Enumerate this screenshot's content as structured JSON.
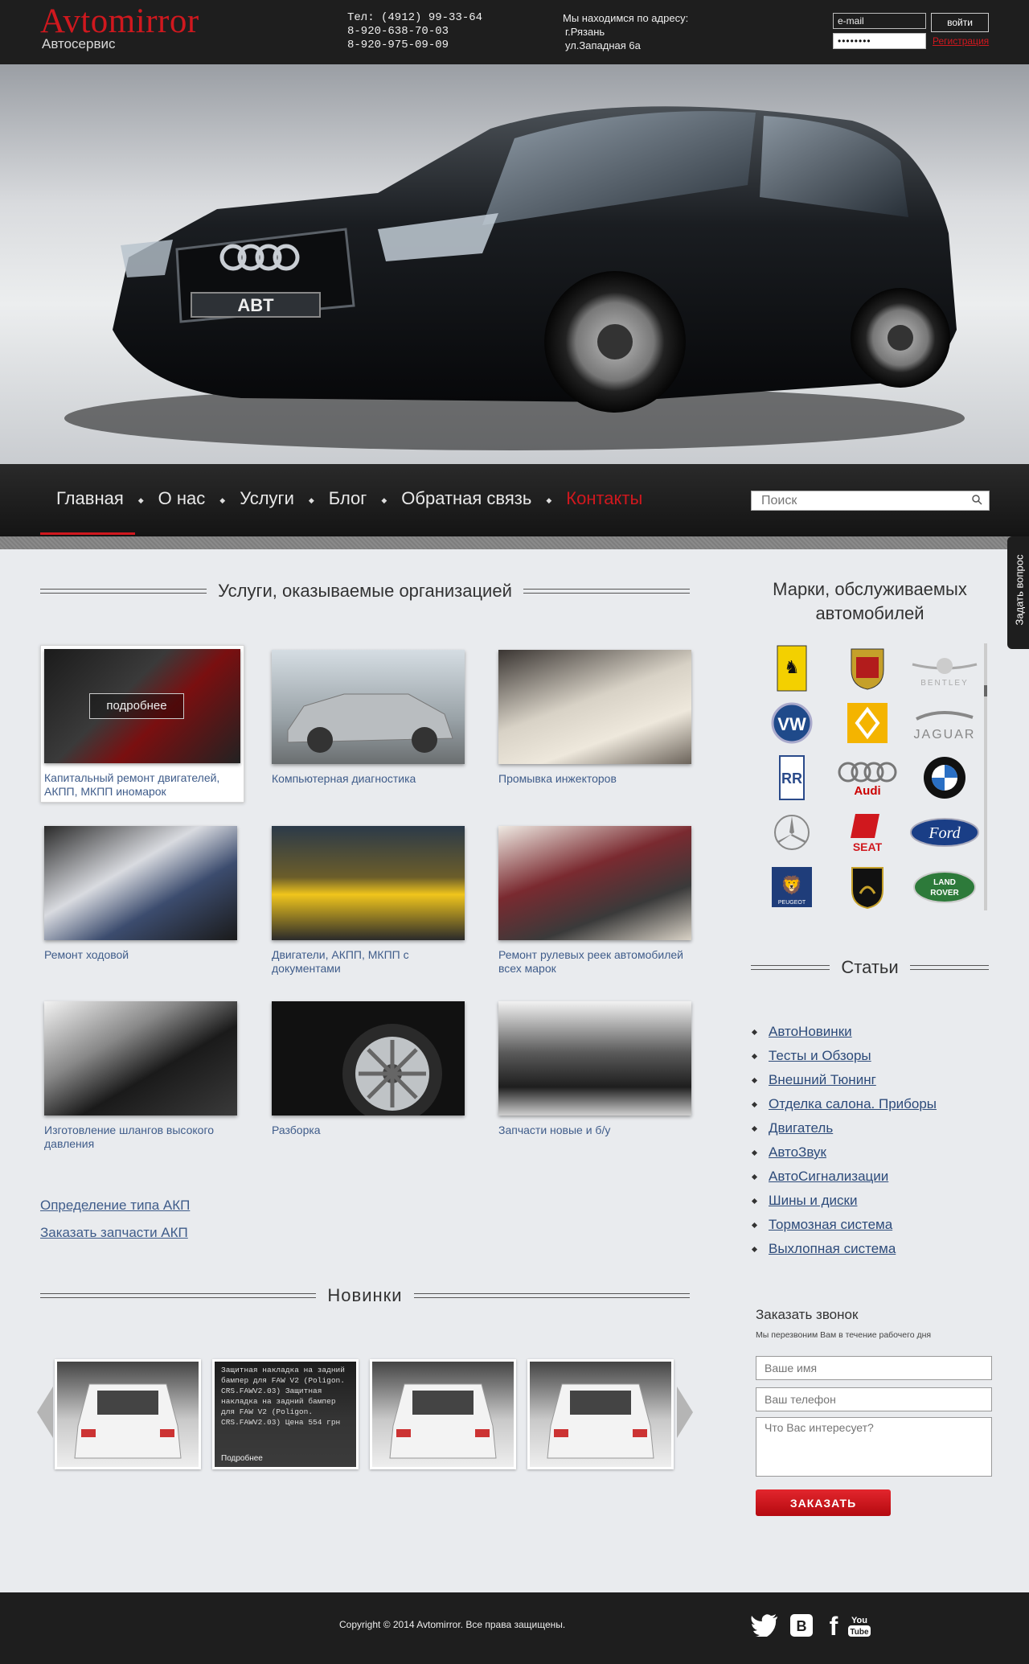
{
  "header": {
    "logo": "Avtomirror",
    "logo_sub": "Автосервис",
    "phones": [
      "Тел: (4912) 99-33-64",
      "8-920-638-70-03",
      "8-920-975-09-09"
    ],
    "address": [
      "Мы находимся по адресу:",
      "г.Рязань",
      "ул.Западная 6а"
    ],
    "email_value": "e-mail",
    "password_value": "••••••••",
    "login_label": "войти",
    "register_label": "Регистрация"
  },
  "nav": {
    "items": [
      "Главная",
      "О нас",
      "Услуги",
      "Блог",
      "Обратная связь",
      "Контакты"
    ],
    "active": "Контакты",
    "search_placeholder": "Поиск"
  },
  "side_tab": "Задать вопрос",
  "services": {
    "title": "Услуги, оказываемые организацией",
    "more_label": "подробнее",
    "items": [
      "Капитальный ремонт двигателей, АКПП, МКПП иномарок",
      "Компьютерная диагностика",
      "Промывка инжекторов",
      "Ремонт ходовой",
      "Двигатели, АКПП, МКПП с документами",
      "Ремонт рулевых реек автомобилей всех марок",
      "Изготовление шлангов высокого давления",
      "Разборка",
      "Запчасти новые и б/у"
    ]
  },
  "links": [
    "Определение типа АКП",
    "Заказать запчасти АКП"
  ],
  "novinki": {
    "title": "Новинки",
    "overlay_text": "Защитная накладка на задний бампер для FAW V2 (Poligon. CRS.FAWV2.03) Защитная накладка на задний бампер для FAW V2 (Poligon. CRS.FAWV2.03) Цена 554 грн",
    "overlay_more": "Подробнее"
  },
  "brands": {
    "title": "Марки, обслуживаемых автомобилей",
    "items": [
      "Ferrari",
      "Porsche",
      "Bentley",
      "Volkswagen",
      "Renault",
      "Jaguar",
      "Rolls-Royce",
      "Audi",
      "BMW",
      "Mercedes-Benz",
      "Seat",
      "Ford",
      "Peugeot",
      "Lamborghini",
      "Land Rover"
    ]
  },
  "articles": {
    "title": "Статьи",
    "items": [
      "АвтоНовинки",
      "Тесты и Обзоры",
      "Внешний Тюнинг",
      "Отделка салона. Приборы",
      "Двигатель",
      "АвтоЗвук",
      "АвтоСигнализации",
      "Шины и диски",
      "Тормозная система",
      "Выхлопная система"
    ]
  },
  "callback": {
    "title": "Заказать звонок",
    "subtitle": "Мы перезвоним Вам в течение рабочего дня",
    "name_placeholder": "Ваше имя",
    "phone_placeholder": "Ваш телефон",
    "message_placeholder": "Что Вас интересует?",
    "submit_label": "ЗАКАЗАТЬ"
  },
  "footer": {
    "copyright": "Copyright © 2014 Avtomirror. Все права защищены.",
    "social": [
      "twitter",
      "vkontakte",
      "facebook",
      "youtube"
    ]
  },
  "colors": {
    "accent": "#d0181e",
    "link": "#3f5c8a",
    "dark": "#1e1e1e"
  }
}
